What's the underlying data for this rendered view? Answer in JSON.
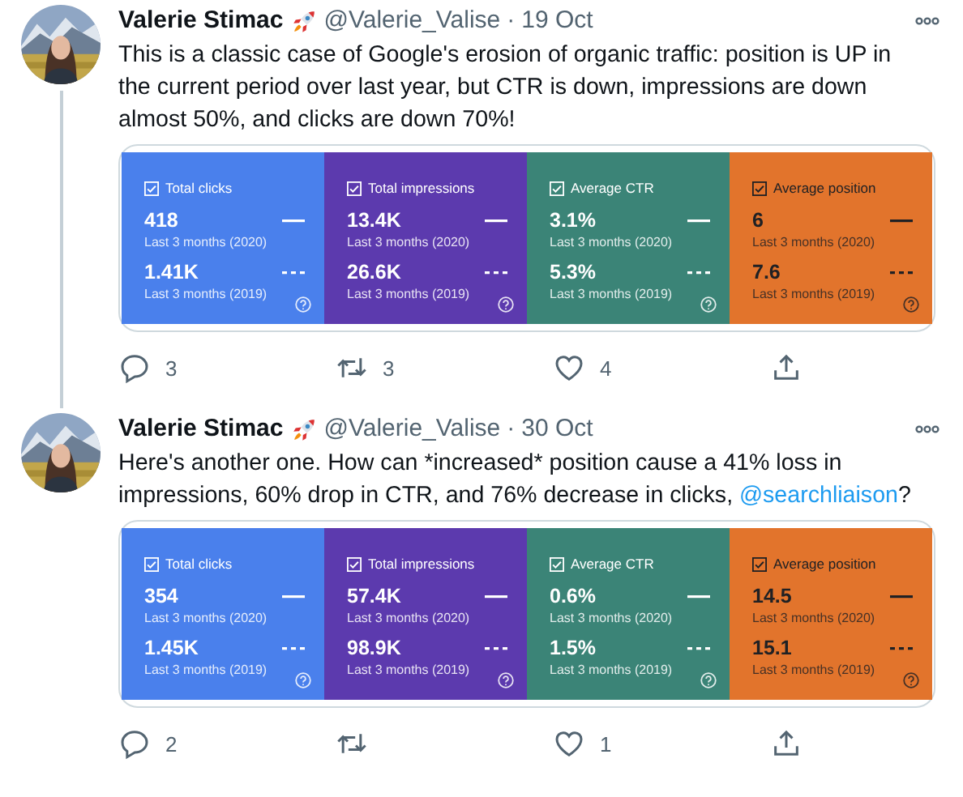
{
  "tweets": [
    {
      "author": "Valerie Stimac",
      "handle": "@Valerie_Valise",
      "separator": "·",
      "date": "19 Oct",
      "threaded": true,
      "text": [
        {
          "kind": "plain",
          "text": "This is a classic case of Google's erosion of organic traffic: position is UP in the current period over last year, but CTR is down, impressions are down almost 50%, and clicks are down 70%!"
        }
      ],
      "metrics": [
        {
          "label": "Total clicks",
          "checked": true,
          "color": "#4a80ec",
          "current": "418",
          "current_period": "Last 3 months (2020)",
          "previous": "1.41K",
          "previous_period": "Last 3 months (2019)"
        },
        {
          "label": "Total impressions",
          "checked": true,
          "color": "#5c3aae",
          "current": "13.4K",
          "current_period": "Last 3 months (2020)",
          "previous": "26.6K",
          "previous_period": "Last 3 months (2019)"
        },
        {
          "label": "Average CTR",
          "checked": true,
          "color": "#3b8477",
          "current": "3.1%",
          "current_period": "Last 3 months (2020)",
          "previous": "5.3%",
          "previous_period": "Last 3 months (2019)"
        },
        {
          "label": "Average position",
          "checked": true,
          "color": "#e2742c",
          "current": "6",
          "current_period": "Last 3 months (2020)",
          "previous": "7.6",
          "previous_period": "Last 3 months (2019)"
        }
      ],
      "actions": [
        {
          "kind": "reply",
          "count": "3"
        },
        {
          "kind": "retweet",
          "count": "3"
        },
        {
          "kind": "like",
          "count": "4"
        },
        {
          "kind": "share"
        }
      ]
    },
    {
      "author": "Valerie Stimac",
      "handle": "@Valerie_Valise",
      "separator": "·",
      "date": "30 Oct",
      "threaded": false,
      "text": [
        {
          "kind": "plain",
          "text": "Here's another one. How can *increased* position cause a 41% loss in impressions, 60% drop in CTR, and 76% decrease in clicks, "
        },
        {
          "kind": "link",
          "text": "@searchliaison"
        },
        {
          "kind": "plain",
          "text": "?"
        }
      ],
      "metrics": [
        {
          "label": "Total clicks",
          "checked": true,
          "color": "#4a80ec",
          "current": "354",
          "current_period": "Last 3 months (2020)",
          "previous": "1.45K",
          "previous_period": "Last 3 months (2019)"
        },
        {
          "label": "Total impressions",
          "checked": true,
          "color": "#5c3aae",
          "current": "57.4K",
          "current_period": "Last 3 months (2020)",
          "previous": "98.9K",
          "previous_period": "Last 3 months (2019)"
        },
        {
          "label": "Average CTR",
          "checked": true,
          "color": "#3b8477",
          "current": "0.6%",
          "current_period": "Last 3 months (2020)",
          "previous": "1.5%",
          "previous_period": "Last 3 months (2019)"
        },
        {
          "label": "Average position",
          "checked": true,
          "color": "#e2742c",
          "current": "14.5",
          "current_period": "Last 3 months (2020)",
          "previous": "15.1",
          "previous_period": "Last 3 months (2019)"
        }
      ],
      "actions": [
        {
          "kind": "reply",
          "count": "2"
        },
        {
          "kind": "retweet"
        },
        {
          "kind": "like",
          "count": "1"
        },
        {
          "kind": "share"
        }
      ]
    }
  ]
}
